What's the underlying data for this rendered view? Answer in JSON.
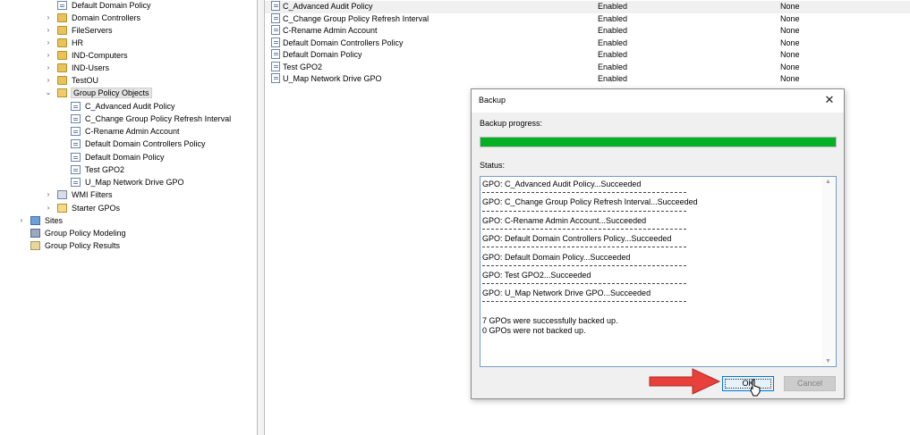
{
  "tree": {
    "items": [
      {
        "label": "Default Domain Policy",
        "icon": "gpo-link-icon",
        "expander": ""
      },
      {
        "label": "Domain Controllers",
        "icon": "ou-folder-icon",
        "expander": "›"
      },
      {
        "label": "FileServers",
        "icon": "ou-folder-icon",
        "expander": "›"
      },
      {
        "label": "HR",
        "icon": "ou-folder-icon",
        "expander": "›"
      },
      {
        "label": "IND-Computers",
        "icon": "ou-folder-icon",
        "expander": "›"
      },
      {
        "label": "IND-Users",
        "icon": "ou-folder-icon",
        "expander": "›"
      },
      {
        "label": "TestOU",
        "icon": "ou-folder-icon",
        "expander": "›"
      },
      {
        "label": "Group Policy Objects",
        "icon": "gpo-container-icon",
        "expander": "⌄"
      },
      {
        "label": "C_Advanced Audit Policy",
        "icon": "gpo-icon",
        "expander": ""
      },
      {
        "label": "C_Change Group Policy Refresh Interval",
        "icon": "gpo-icon",
        "expander": ""
      },
      {
        "label": "C-Rename Admin Account",
        "icon": "gpo-icon",
        "expander": ""
      },
      {
        "label": "Default Domain Controllers Policy",
        "icon": "gpo-icon",
        "expander": ""
      },
      {
        "label": "Default Domain Policy",
        "icon": "gpo-icon",
        "expander": ""
      },
      {
        "label": "Test GPO2",
        "icon": "gpo-icon",
        "expander": ""
      },
      {
        "label": "U_Map Network Drive GPO",
        "icon": "gpo-icon",
        "expander": ""
      },
      {
        "label": "WMI Filters",
        "icon": "wmi-filters-icon",
        "expander": "›"
      },
      {
        "label": "Starter GPOs",
        "icon": "starter-gpos-icon",
        "expander": "›"
      },
      {
        "label": "Sites",
        "icon": "sites-icon",
        "expander": "›"
      },
      {
        "label": "Group Policy Modeling",
        "icon": "gp-modeling-icon",
        "expander": ""
      },
      {
        "label": "Group Policy Results",
        "icon": "gp-results-icon",
        "expander": ""
      }
    ]
  },
  "gpo_list": {
    "rows": [
      {
        "name": "C_Advanced Audit Policy",
        "status": "Enabled",
        "wmi": "None"
      },
      {
        "name": "C_Change Group Policy Refresh Interval",
        "status": "Enabled",
        "wmi": "None"
      },
      {
        "name": "C-Rename Admin Account",
        "status": "Enabled",
        "wmi": "None"
      },
      {
        "name": "Default Domain Controllers Policy",
        "status": "Enabled",
        "wmi": "None"
      },
      {
        "name": "Default Domain Policy",
        "status": "Enabled",
        "wmi": "None"
      },
      {
        "name": "Test GPO2",
        "status": "Enabled",
        "wmi": "None"
      },
      {
        "name": "U_Map Network Drive GPO",
        "status": "Enabled",
        "wmi": "None"
      }
    ]
  },
  "dialog": {
    "title": "Backup",
    "close_glyph": "✕",
    "progress_label": "Backup progress:",
    "progress_fraction": 1.0,
    "progress_color": "#06b025",
    "status_label": "Status:",
    "status_lines": [
      "GPO: C_Advanced Audit Policy...Succeeded",
      "GPO: C_Change Group Policy Refresh Interval...Succeeded",
      "GPO: C-Rename Admin Account...Succeeded",
      "GPO: Default Domain Controllers Policy...Succeeded",
      "GPO: Default Domain Policy...Succeeded",
      "GPO: Test GPO2...Succeeded",
      "GPO: U_Map Network Drive GPO...Succeeded"
    ],
    "summary_lines": [
      "7 GPOs were successfully backed up.",
      "0 GPOs were not backed up."
    ],
    "ok_label": "OK",
    "cancel_label": "Cancel"
  },
  "annotation": {
    "arrow_color": "#e8403a"
  }
}
